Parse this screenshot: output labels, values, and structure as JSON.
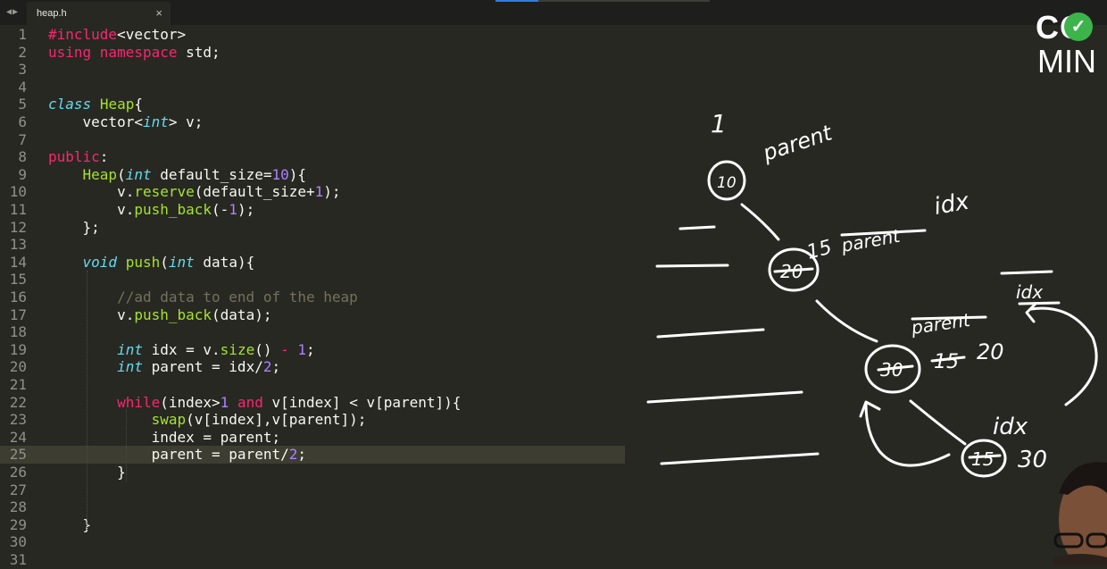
{
  "tab": {
    "title": "heap.h",
    "close": "×",
    "nav_left": "◀",
    "nav_right": "▶"
  },
  "logo": {
    "line1": "CO",
    "check": "✓",
    "line2": "MIN"
  },
  "code_lines": [
    {
      "n": "1",
      "segs": [
        [
          "kw",
          "#include"
        ],
        [
          "",
          "<vector>"
        ]
      ]
    },
    {
      "n": "2",
      "segs": [
        [
          "kw",
          "using namespace"
        ],
        [
          "",
          " std;"
        ]
      ]
    },
    {
      "n": "3",
      "segs": []
    },
    {
      "n": "4",
      "segs": []
    },
    {
      "n": "5",
      "segs": [
        [
          "st",
          "class"
        ],
        [
          "",
          " "
        ],
        [
          "fn",
          "Heap"
        ],
        [
          "",
          "{"
        ]
      ]
    },
    {
      "n": "6",
      "segs": [
        [
          "",
          "    vector<"
        ],
        [
          "st",
          "int"
        ],
        [
          "",
          "> v;"
        ]
      ]
    },
    {
      "n": "7",
      "segs": []
    },
    {
      "n": "8",
      "segs": [
        [
          "kw",
          "public"
        ],
        [
          "",
          ":"
        ]
      ]
    },
    {
      "n": "9",
      "segs": [
        [
          "",
          "    "
        ],
        [
          "fn",
          "Heap"
        ],
        [
          "",
          "("
        ],
        [
          "st",
          "int"
        ],
        [
          "",
          " default_size="
        ],
        [
          "nm",
          "10"
        ],
        [
          "",
          "){"
        ]
      ]
    },
    {
      "n": "10",
      "segs": [
        [
          "",
          "        v."
        ],
        [
          "fn",
          "reserve"
        ],
        [
          "",
          "(default_size+"
        ],
        [
          "nm",
          "1"
        ],
        [
          "",
          ");"
        ]
      ]
    },
    {
      "n": "11",
      "segs": [
        [
          "",
          "        v."
        ],
        [
          "fn",
          "push_back"
        ],
        [
          "",
          "(-"
        ],
        [
          "nm",
          "1"
        ],
        [
          "",
          ");"
        ]
      ]
    },
    {
      "n": "12",
      "segs": [
        [
          "",
          "    };"
        ]
      ]
    },
    {
      "n": "13",
      "segs": []
    },
    {
      "n": "14",
      "segs": [
        [
          "",
          "    "
        ],
        [
          "st",
          "void"
        ],
        [
          "",
          " "
        ],
        [
          "fn",
          "push"
        ],
        [
          "",
          "("
        ],
        [
          "st",
          "int"
        ],
        [
          "",
          " data){"
        ]
      ]
    },
    {
      "n": "15",
      "segs": []
    },
    {
      "n": "16",
      "segs": [
        [
          "",
          "        "
        ],
        [
          "cm",
          "//ad data to end of the heap"
        ]
      ]
    },
    {
      "n": "17",
      "segs": [
        [
          "",
          "        v."
        ],
        [
          "fn",
          "push_back"
        ],
        [
          "",
          "(data);"
        ]
      ]
    },
    {
      "n": "18",
      "segs": []
    },
    {
      "n": "19",
      "segs": [
        [
          "",
          "        "
        ],
        [
          "st",
          "int"
        ],
        [
          "",
          " idx = v."
        ],
        [
          "fn",
          "size"
        ],
        [
          "",
          "() "
        ],
        [
          "kw",
          "-"
        ],
        [
          "",
          " "
        ],
        [
          "nm",
          "1"
        ],
        [
          "",
          ";"
        ]
      ]
    },
    {
      "n": "20",
      "segs": [
        [
          "",
          "        "
        ],
        [
          "st",
          "int"
        ],
        [
          "",
          " parent = idx/"
        ],
        [
          "nm",
          "2"
        ],
        [
          "",
          ";"
        ]
      ]
    },
    {
      "n": "21",
      "segs": []
    },
    {
      "n": "22",
      "segs": [
        [
          "",
          "        "
        ],
        [
          "kw",
          "while"
        ],
        [
          "",
          "(index>"
        ],
        [
          "nm",
          "1"
        ],
        [
          "",
          " "
        ],
        [
          "kw",
          "and"
        ],
        [
          "",
          " v[index] < v[parent]){"
        ]
      ]
    },
    {
      "n": "23",
      "segs": [
        [
          "",
          "            "
        ],
        [
          "fn",
          "swap"
        ],
        [
          "",
          "(v[index],v[parent]);"
        ]
      ]
    },
    {
      "n": "24",
      "segs": [
        [
          "",
          "            index = parent;"
        ]
      ]
    },
    {
      "n": "25",
      "segs": [
        [
          "",
          "            parent = parent/"
        ],
        [
          "nm",
          "2"
        ],
        [
          "",
          ";"
        ]
      ]
    },
    {
      "n": "26",
      "segs": [
        [
          "",
          "        }"
        ]
      ]
    },
    {
      "n": "27",
      "segs": []
    },
    {
      "n": "28",
      "segs": []
    },
    {
      "n": "29",
      "segs": [
        [
          "",
          "    }"
        ]
      ]
    },
    {
      "n": "30",
      "segs": []
    },
    {
      "n": "31",
      "segs": []
    }
  ],
  "active_line": 25,
  "annotations": {
    "one": "1",
    "parent_top": "parent",
    "idx_top": "idx",
    "node_10": "10",
    "node_20": "20",
    "node_20_label": "15",
    "node_20_note": "parent",
    "node_30": "30",
    "node_30_note": "parent",
    "node_30_value": "20",
    "node_30_old": "15",
    "idx_right": "idx",
    "idx_bottom": "idx",
    "node_15": "15",
    "node_15_value": "30"
  }
}
